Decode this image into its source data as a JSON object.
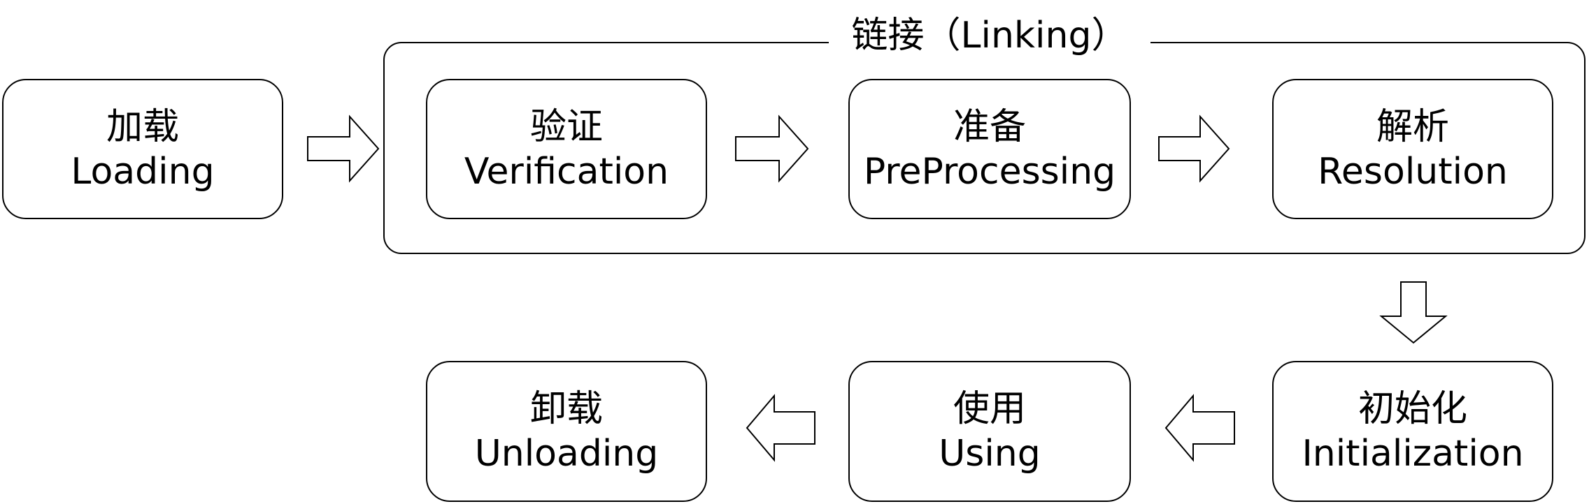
{
  "group": {
    "title": "链接（Linking）"
  },
  "stages": {
    "loading": {
      "zh": "加载",
      "en": "Loading"
    },
    "verification": {
      "zh": "验证",
      "en": "Verification"
    },
    "preprocessing": {
      "zh": "准备",
      "en": "PreProcessing"
    },
    "resolution": {
      "zh": "解析",
      "en": "Resolution"
    },
    "initialization": {
      "zh": "初始化",
      "en": "Initialization"
    },
    "using": {
      "zh": "使用",
      "en": "Using"
    },
    "unloading": {
      "zh": "卸载",
      "en": "Unloading"
    }
  }
}
